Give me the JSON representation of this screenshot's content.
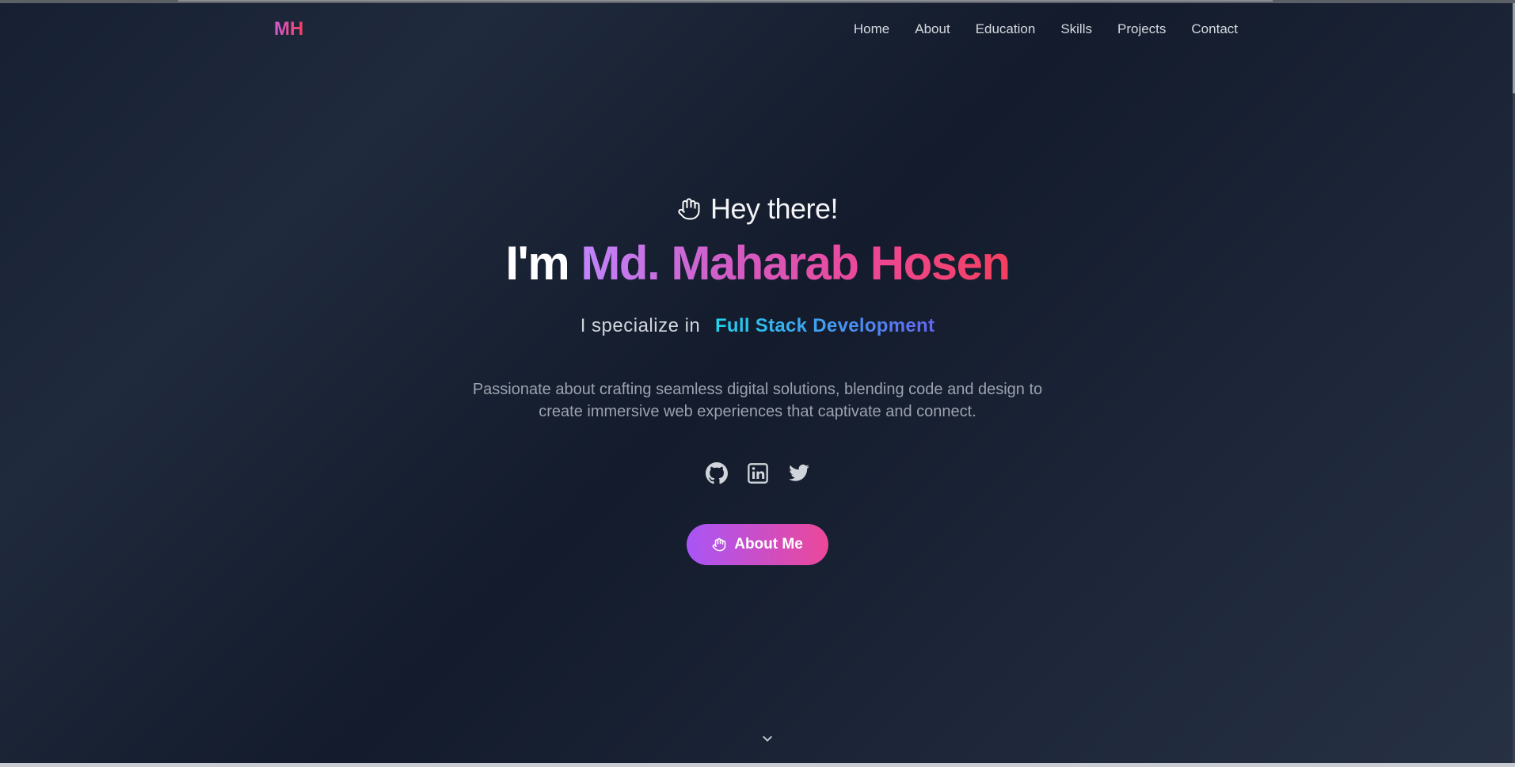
{
  "header": {
    "logo": "MH",
    "nav": [
      "Home",
      "About",
      "Education",
      "Skills",
      "Projects",
      "Contact"
    ]
  },
  "hero": {
    "greeting": "Hey there!",
    "greeting_icon": "hand-icon",
    "intro_prefix": "I'm",
    "name": "Md. Maharab Hosen",
    "specialize_prefix": "I specialize in",
    "specialize_value": "Full Stack Development",
    "description": "Passionate about crafting seamless digital solutions, blending code and design to create immersive web experiences that captivate and connect.",
    "socials": [
      "github-icon",
      "linkedin-icon",
      "twitter-icon"
    ],
    "cta_label": "About Me",
    "cta_icon": "hand-icon"
  },
  "footer": {
    "scroll_icon": "chevron-down-icon"
  },
  "colors": {
    "accent_purple": "#a855f7",
    "accent_pink": "#ec4899",
    "accent_red": "#f43f5e",
    "accent_cyan": "#22d3ee",
    "accent_indigo": "#6366f1",
    "background": "#172033"
  }
}
